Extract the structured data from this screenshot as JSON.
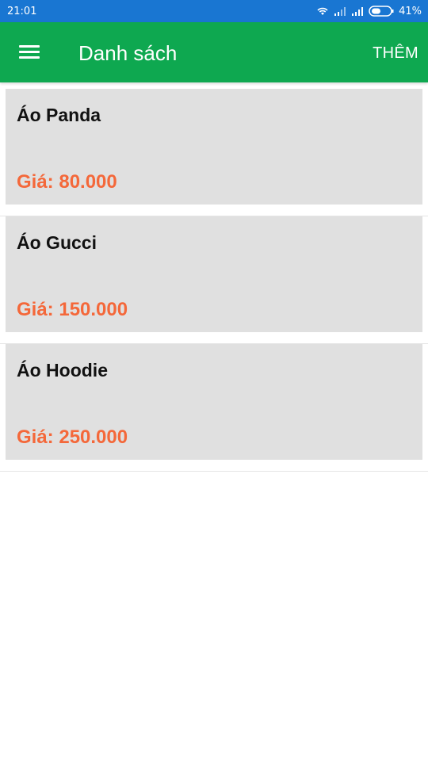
{
  "status_bar": {
    "time": "21:01",
    "battery": "41%",
    "icons": [
      "wifi-icon",
      "signal-icon",
      "signal-icon",
      "battery-icon"
    ]
  },
  "app_bar": {
    "menu_icon": "menu-icon",
    "title": "Danh sách",
    "action_label": "THÊM"
  },
  "products": [
    {
      "name": "Áo Panda",
      "price": "Giá: 80.000"
    },
    {
      "name": "Áo Gucci",
      "price": "Giá: 150.000"
    },
    {
      "name": "Áo Hoodie",
      "price": "Giá: 250.000"
    }
  ],
  "colors": {
    "status_bar": "#1976d2",
    "app_bar": "#0ea850",
    "card": "#e0e0e0",
    "price": "#f4683a"
  }
}
